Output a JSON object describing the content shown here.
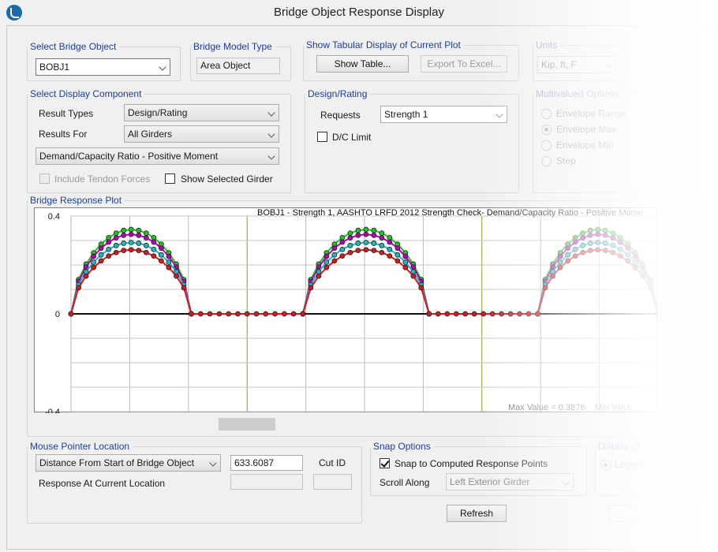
{
  "window": {
    "title": "Bridge Object Response Display"
  },
  "select_bridge_object": {
    "label": "Select Bridge Object",
    "value": "BOBJ1"
  },
  "bridge_model_type": {
    "label": "Bridge Model Type",
    "value": "Area Object"
  },
  "tabular": {
    "label": "Show Tabular Display of Current Plot",
    "show_table": "Show Table...",
    "export": "Export To Excel..."
  },
  "units": {
    "label": "Units",
    "value": "Kip, ft, F"
  },
  "display_component": {
    "label": "Select Display Component",
    "result_types_label": "Result Types",
    "result_types_value": "Design/Rating",
    "results_for_label": "Results For",
    "results_for_value": "All Girders",
    "component_value": "Demand/Capacity Ratio - Positive Moment",
    "include_tendon": "Include Tendon Forces",
    "show_selected_girder": "Show Selected Girder"
  },
  "design_rating": {
    "label": "Design/Rating",
    "requests_label": "Requests",
    "requests_value": "Strength 1",
    "dc_limit": "D/C Limit"
  },
  "multivalued": {
    "label": "Multivalued Options",
    "options": [
      "Envelope Range",
      "Envelope Max",
      "Envelope Min",
      "Step"
    ],
    "selected": "Envelope Max"
  },
  "plot": {
    "label": "Bridge Response Plot"
  },
  "mouse_pointer": {
    "label": "Mouse Pointer Location",
    "distance_option": "Distance From Start of Bridge Object",
    "distance_value": "633.6087",
    "cut_id_label": "Cut ID",
    "cut_id_value": "",
    "response_label": "Response At Current Location",
    "response_value": ""
  },
  "snap": {
    "label": "Snap Options",
    "snap_label": "Snap to Computed Response Points",
    "snap_checked": true,
    "scroll_along_label": "Scroll Along",
    "scroll_along_value": "Left Exterior Girder"
  },
  "refresh": "Refresh",
  "display_label": "Display O",
  "display_option": "Legend",
  "chart_data": {
    "type": "line",
    "title": "BOBJ1 - Strength 1, AASHTO LRFD 2012 Strength Check- Demand/Capacity Ratio - Positive Mome",
    "ylim": [
      -0.4,
      0.4
    ],
    "yticks": [
      "0.4",
      "0",
      "-0.4"
    ],
    "max_value_text": "Max Value = 0.3876",
    "min_value_text": "Min Value",
    "xlim": [
      0,
      1000
    ],
    "grid": true,
    "peaks": [
      {
        "start": 0,
        "end": 205,
        "skew": 0.0
      },
      {
        "start": 395,
        "end": 610,
        "skew": 0.0
      },
      {
        "start": 795,
        "end": 1000,
        "skew": 0.0
      }
    ],
    "series": [
      {
        "color": "#22c422",
        "values_peak": 0.345
      },
      {
        "color": "#b400b4",
        "values_peak": 0.325
      },
      {
        "color": "#1fb7c4",
        "values_peak": 0.292
      },
      {
        "color": "#d41a1a",
        "values_peak": 0.262
      }
    ]
  }
}
